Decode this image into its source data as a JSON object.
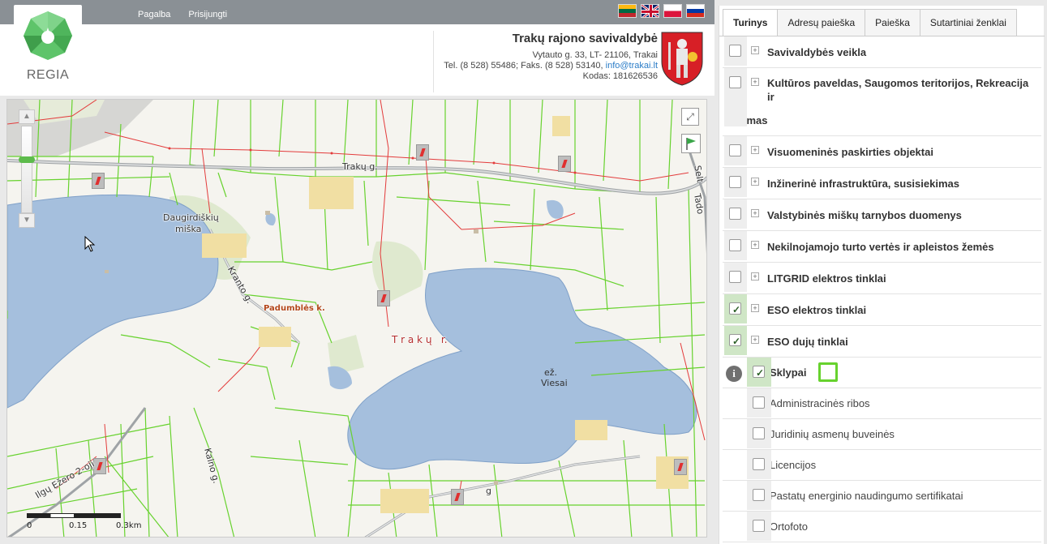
{
  "topbar": {
    "links": [
      "Pagalba",
      "Prisijungti"
    ],
    "flags": [
      "lt-flag",
      "gb-flag",
      "pl-flag",
      "ru-flag"
    ]
  },
  "logo": {
    "text": "REGIA"
  },
  "municipality": {
    "name": "Trakų rajono savivaldybė",
    "address": "Vytauto g. 33, LT- 21106, Trakai",
    "phone_prefix": "Tel. (8 528) 55486; Faks. (8 528) 53140,",
    "email": "info@trakai.lt",
    "code": "Kodas: 181626536"
  },
  "map": {
    "labels": {
      "road_trakai": "Trakų g.",
      "forest": "Daugirdiškių",
      "forest2": "miška",
      "road_krakto": "Kranto g.",
      "padumbles": "Padumblės k.",
      "trakai_r": "T r a k ų   r.",
      "lake1": "ež.",
      "lake2": "Viesai",
      "road_kalno": "Kalno g.",
      "road_ilgu": "Ilgų Ežero 2-oji",
      "road_sell": "Selt",
      "road_sell2": "Tado",
      "road_g": "g"
    },
    "scale": {
      "labels": [
        "0",
        "0.15",
        "0.3km"
      ]
    },
    "colors": {
      "water": "#a5bfdd",
      "parcel": "#67d22e",
      "road": "#9fa3a6",
      "power": "#e33b3b"
    }
  },
  "panel": {
    "tabs": [
      {
        "label": "Turinys",
        "active": true
      },
      {
        "label": "Adresų paieška",
        "active": false
      },
      {
        "label": "Paieška",
        "active": false
      },
      {
        "label": "Sutartiniai ženklai",
        "active": false
      }
    ],
    "layers": [
      {
        "label": "Savivaldybės veikla",
        "checked": false
      },
      {
        "label": "Kultūros paveldas, Saugomos teritorijos, Rekreacija ir",
        "label2": "turizmas",
        "checked": false
      },
      {
        "label": "Visuomeninės paskirties objektai",
        "checked": false
      },
      {
        "label": "Inžinerinė infrastruktūra, susisiekimas",
        "checked": false
      },
      {
        "label": "Valstybinės miškų tarnybos duomenys",
        "checked": false
      },
      {
        "label": "Nekilnojamojo turto vertės ir apleistos žemės",
        "checked": false
      },
      {
        "label": "LITGRID elektros tinklai",
        "checked": false
      },
      {
        "label": "ESO elektros tinklai",
        "checked": true
      },
      {
        "label": "ESO dujų tinklai",
        "checked": true
      }
    ],
    "sklypai": {
      "label": "Sklypai",
      "checked": true
    },
    "sublayers": [
      "Administracinės ribos",
      "Juridinių asmenų buveinės",
      "Licencijos",
      "Pastatų energinio naudingumo sertifikatai",
      "Ortofoto"
    ]
  }
}
